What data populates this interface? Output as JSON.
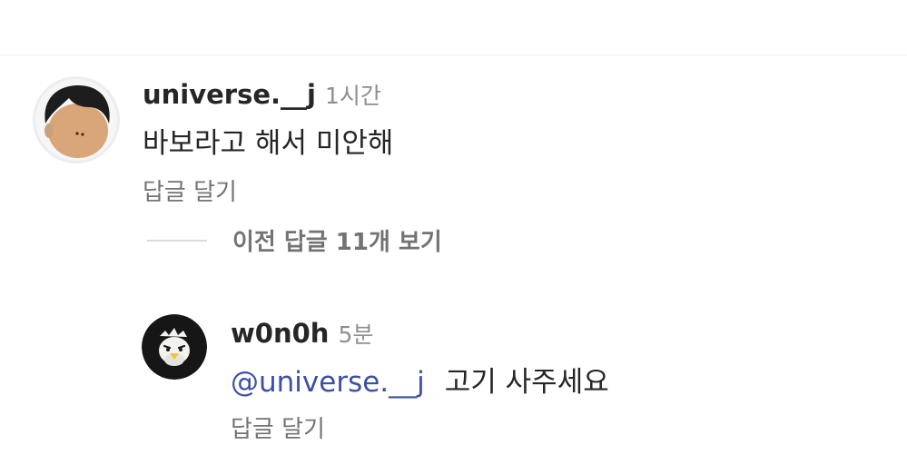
{
  "comment": {
    "username": "universe.__j",
    "time": "1시간",
    "text": "바보라고 해서 미안해",
    "reply_label": "답글 달기",
    "avatar_icon": "profile-avatar",
    "view_replies_label": "이전 답글 11개 보기"
  },
  "reply": {
    "username": "w0n0h",
    "time": "5분",
    "mention": "@universe.__j",
    "text": "고기 사주세요",
    "reply_label": "답글 달기",
    "avatar_icon": "bird-avatar"
  },
  "colors": {
    "mention": "#3c4fa6",
    "secondary_text": "#8e8e8e",
    "primary_text": "#262626"
  }
}
